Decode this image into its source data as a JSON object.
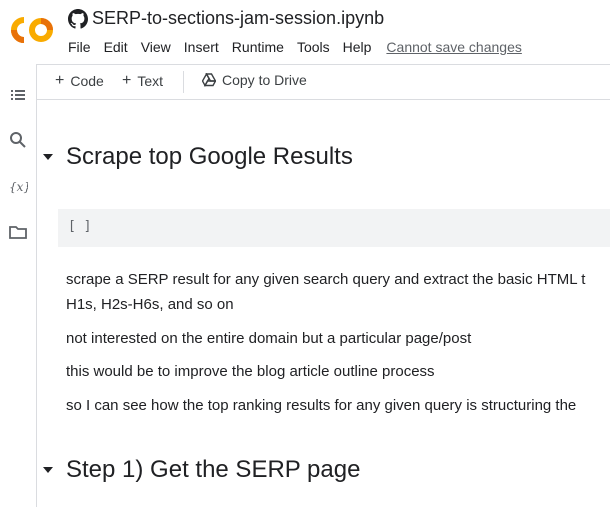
{
  "app": {
    "logo_text": "CO",
    "notebook_title": "SERP-to-sections-jam-session.ipynb"
  },
  "menu": {
    "items": [
      "File",
      "Edit",
      "View",
      "Insert",
      "Runtime",
      "Tools",
      "Help"
    ],
    "status_link": "Cannot save changes"
  },
  "toolbar": {
    "code_label": "Code",
    "text_label": "Text",
    "copy_to_drive_label": "Copy to Drive"
  },
  "sidebar": {
    "icons": [
      "table-of-contents-icon",
      "search-icon",
      "variables-icon",
      "folder-icon"
    ]
  },
  "notebook": {
    "section1_title": "Scrape top Google Results",
    "code_cell_run": "[ ]",
    "paragraphs": [
      "scrape a SERP result for any given search query and extract the basic HTML t",
      "H1s, H2s-H6s, and so on",
      "not interested on the entire domain but a particular page/post",
      "this would be to improve the blog article outline process",
      "so I can see how the top ranking results for any given query is structuring the"
    ],
    "section2_title": "Step 1) Get the SERP page"
  },
  "colors": {
    "logo_orange": "#f9ab00",
    "logo_dark_orange": "#e8710a",
    "text": "#202124",
    "muted": "#5f6368",
    "cell_bg": "#f2f3f4",
    "divider": "#dadce0"
  }
}
